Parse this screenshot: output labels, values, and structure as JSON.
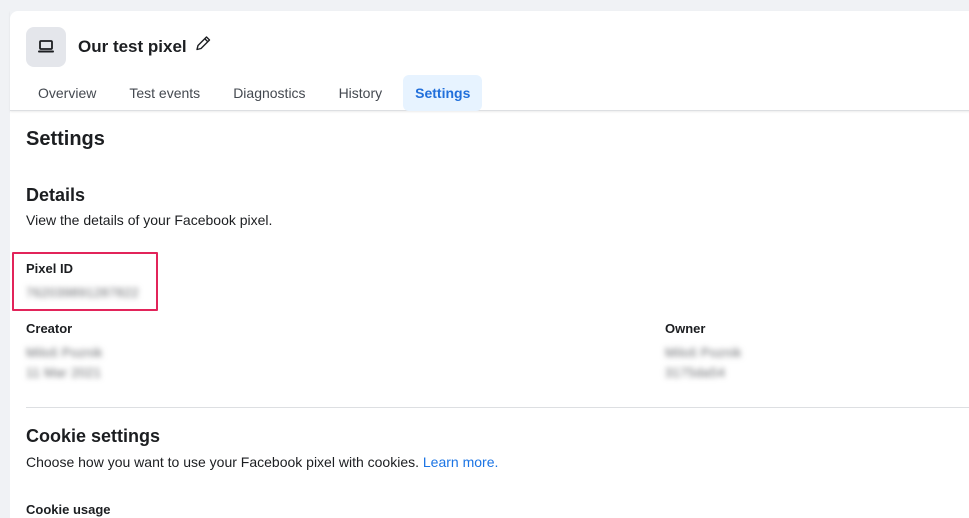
{
  "header": {
    "pixel_name": "Our test pixel",
    "tabs": [
      {
        "label": "Overview",
        "active": false
      },
      {
        "label": "Test events",
        "active": false
      },
      {
        "label": "Diagnostics",
        "active": false
      },
      {
        "label": "History",
        "active": false
      },
      {
        "label": "Settings",
        "active": true
      }
    ]
  },
  "page": {
    "title": "Settings"
  },
  "details": {
    "title": "Details",
    "description": "View the details of your Facebook pixel.",
    "pixel_id_label": "Pixel ID",
    "pixel_id_value": "762039891287822",
    "creator_label": "Creator",
    "creator_name": "Miloš Poznik",
    "creator_date": "11 Mar 2021",
    "owner_label": "Owner",
    "owner_name": "Miloš Poznik",
    "owner_id": "3175da54"
  },
  "cookies": {
    "title": "Cookie settings",
    "description": "Choose how you want to use your Facebook pixel with cookies.",
    "learn_more": "Learn more.",
    "usage_label": "Cookie usage"
  },
  "colors": {
    "accent": "#1877f2",
    "highlight": "#e2245a",
    "active_tab_bg": "#e7f3ff"
  }
}
